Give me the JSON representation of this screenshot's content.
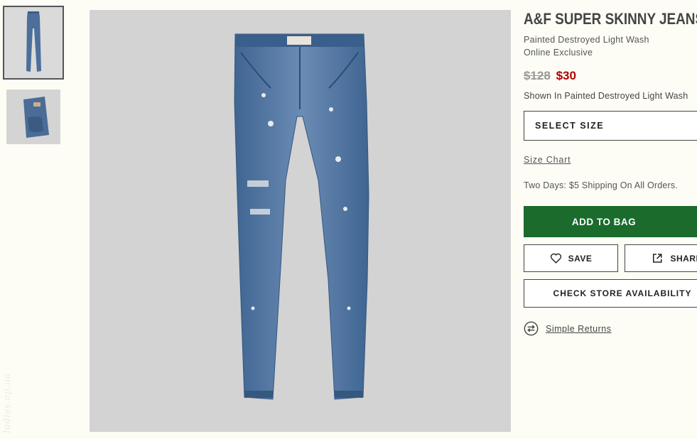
{
  "product": {
    "title": "A&F SUPER SKINNY JEANS",
    "color_name": "Painted Destroyed Light Wash",
    "availability": "Online Exclusive",
    "price_original": "$128",
    "price_sale": "$30",
    "shown_in": "Shown In Painted Destroyed Light Wash"
  },
  "actions": {
    "select_size": "SELECT SIZE",
    "size_chart": "Size Chart",
    "shipping_note": "Two Days: $5 Shipping On All Orders.",
    "add_to_bag": "ADD TO BAG",
    "save": "SAVE",
    "share": "SHARE",
    "check_store": "CHECK STORE AVAILABILITY",
    "simple_returns": "Simple Returns"
  },
  "watermark": "ladies.ap.ua",
  "icons": {
    "save": "heart-icon",
    "share": "share-external-icon",
    "returns": "exchange-arrows-icon"
  },
  "colors": {
    "add_to_bag_bg": "#1a6b2c",
    "sale_price": "#b00000",
    "original_price": "#999999",
    "denim": "#4a6f9c"
  }
}
